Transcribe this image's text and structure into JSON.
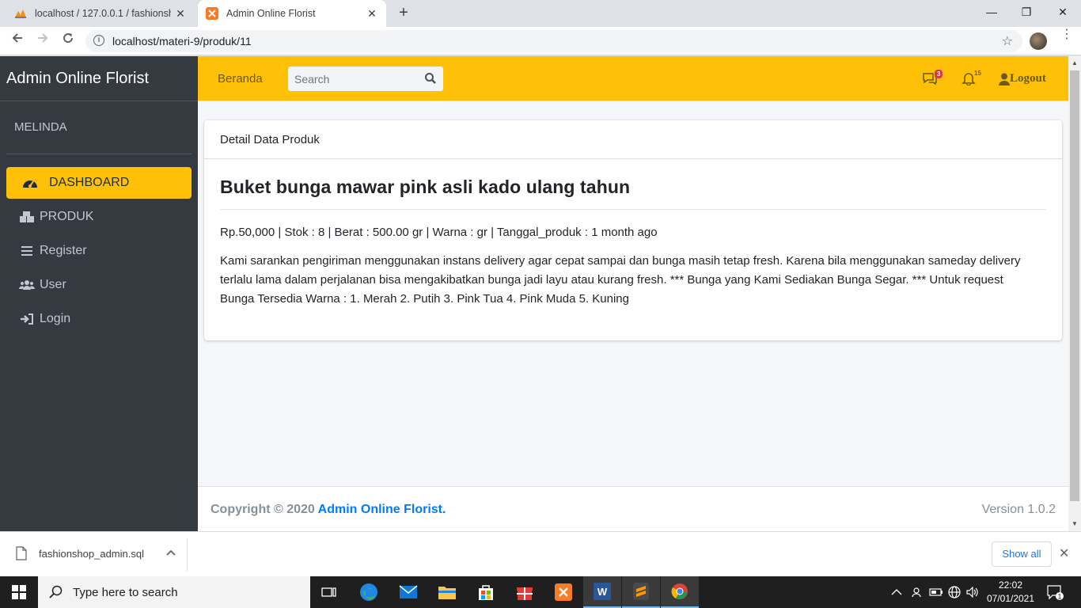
{
  "browser": {
    "tabs": [
      {
        "title": "localhost / 127.0.0.1 / fashionsho",
        "active": false
      },
      {
        "title": "Admin Online Florist",
        "active": true
      }
    ],
    "url": "localhost/materi-9/produk/11"
  },
  "sidebar": {
    "brand": "Admin Online Florist",
    "user": "MELINDA",
    "items": [
      {
        "label": "DASHBOARD",
        "icon": "tachometer-icon",
        "active": true
      },
      {
        "label": "PRODUK",
        "icon": "boxes-icon",
        "active": false
      },
      {
        "label": "Register",
        "icon": "list-icon",
        "active": false
      },
      {
        "label": "User",
        "icon": "users-icon",
        "active": false
      },
      {
        "label": "Login",
        "icon": "sign-in-icon",
        "active": false
      }
    ]
  },
  "topnav": {
    "home_label": "Beranda",
    "search_placeholder": "Search",
    "messages_count": "3",
    "notifications_count": "15",
    "logout_label": "Logout"
  },
  "card": {
    "header": "Detail Data Produk",
    "title": "Buket bunga mawar pink asli kado ulang tahun",
    "meta": "Rp.50,000 | Stok : 8 | Berat : 500.00 gr | Warna : gr | Tanggal_produk : 1 month ago",
    "description": "Kami sarankan pengiriman menggunakan instans delivery agar cepat sampai dan bunga masih tetap fresh. Karena bila menggunakan sameday delivery terlalu lama dalam perjalanan bisa mengakibatkan bunga jadi layu atau kurang fresh. *** Bunga yang Kami Sediakan Bunga Segar. *** Untuk request Bunga Tersedia Warna : 1. Merah 2. Putih 3. Pink Tua 4. Pink Muda 5. Kuning"
  },
  "footer": {
    "copyright_prefix": "Copyright © 2020 ",
    "copyright_link": "Admin Online Florist.",
    "version": "Version 1.0.2"
  },
  "downloads": {
    "filename": "fashionshop_admin.sql",
    "show_all": "Show all"
  },
  "taskbar": {
    "search_placeholder": "Type here to search",
    "time": "22:02",
    "date": "07/01/2021",
    "notification_count": "1"
  },
  "colors": {
    "accent": "#ffc107",
    "sidebar": "#343a40",
    "link": "#007bff"
  }
}
